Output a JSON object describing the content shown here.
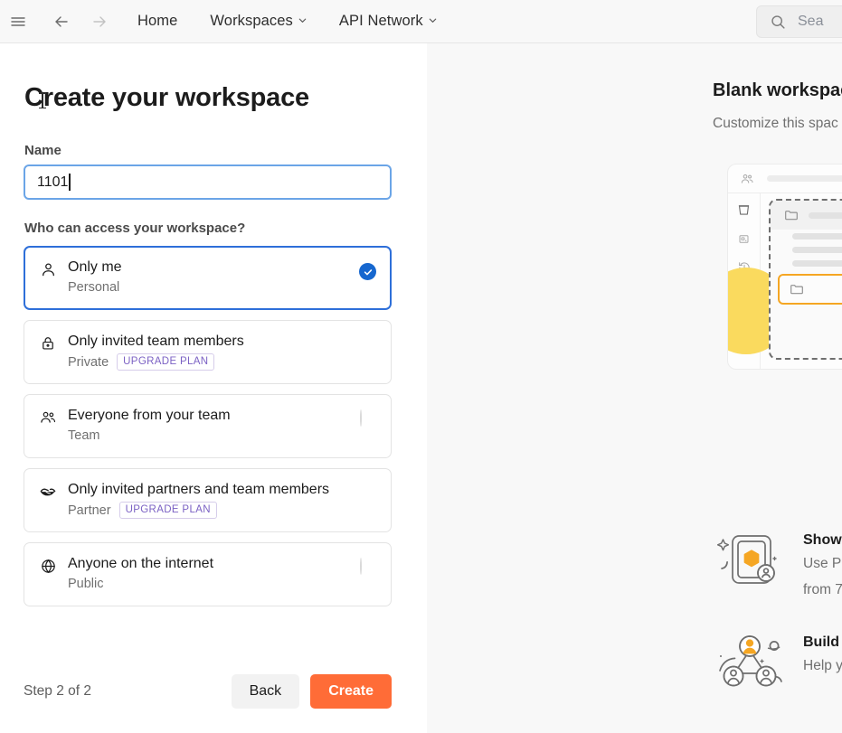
{
  "topbar": {
    "menu_icon": "hamburger-icon",
    "back_icon": "arrow-left-icon",
    "forward_icon": "arrow-right-icon",
    "links": [
      {
        "label": "Home",
        "has_chevron": false
      },
      {
        "label": "Workspaces",
        "has_chevron": true
      },
      {
        "label": "API Network",
        "has_chevron": true
      }
    ],
    "chevron": "⌄",
    "search": {
      "icon": "search-icon",
      "placeholder": "Sea"
    }
  },
  "form": {
    "title": "Create your workspace",
    "name_label": "Name",
    "name_value": "1101",
    "name_placeholder": "",
    "access_label": "Who can access your workspace?",
    "options": [
      {
        "icon": "person-icon",
        "title": "Only me",
        "subtitle": "Personal",
        "badge": "",
        "state": "checked"
      },
      {
        "icon": "lock-icon",
        "title": "Only invited team members",
        "subtitle": "Private",
        "badge": "UPGRADE PLAN",
        "state": "none"
      },
      {
        "icon": "people-icon",
        "title": "Everyone from your team",
        "subtitle": "Team",
        "badge": "",
        "state": "empty"
      },
      {
        "icon": "handshake-icon",
        "title": "Only invited partners and team members",
        "subtitle": "Partner",
        "badge": "UPGRADE PLAN",
        "state": "none"
      },
      {
        "icon": "globe-icon",
        "title": "Anyone on the internet",
        "subtitle": "Public",
        "badge": "",
        "state": "empty"
      }
    ],
    "footer": {
      "step": "Step 2 of 2",
      "back_label": "Back",
      "create_label": "Create"
    }
  },
  "preview": {
    "title": "Blank workspac",
    "subtitle": "Customize this spac",
    "illustration_name": "blank-workspace-illustration",
    "features": [
      {
        "art": "showcase-api-illustration",
        "title": "Show",
        "desc_line_1": "Use P",
        "desc_line_2": "from 7"
      },
      {
        "art": "build-team-illustration",
        "title": "Build",
        "desc_line_1": "Help y",
        "desc_line_2": ""
      }
    ]
  },
  "colors": {
    "accent_orange": "#ff6c37",
    "selected_blue": "#2e6fd9",
    "check_blue": "#1667cf",
    "input_focus_blue": "#6ba5e7",
    "badge_purple": "#7b61c4",
    "illustration_yellow": "#fada5e",
    "panel_bg": "#f8f8f8"
  }
}
